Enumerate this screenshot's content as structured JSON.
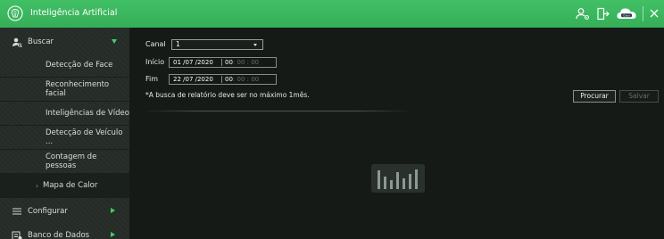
{
  "app": {
    "title": "Inteligência Artificial",
    "accent": "#3fb862"
  },
  "header_icons": [
    "user-settings-icon",
    "logout-icon",
    "cloud-icon",
    "close-icon"
  ],
  "cloud_badge": "Intelbras\nCloud",
  "sidebar": {
    "buscar": {
      "label": "Buscar",
      "icon": "search-person-icon"
    },
    "sub_items": [
      {
        "label": "Detecção de Face"
      },
      {
        "label": "Reconhecimento facial"
      },
      {
        "label": "Inteligências de Vídeo"
      },
      {
        "label": "Detecção de Veículo ..."
      },
      {
        "label": "Contagem de pessoas"
      },
      {
        "label": "Mapa de Calor",
        "active": true,
        "bullet": "›"
      }
    ],
    "configurar": {
      "label": "Configurar",
      "icon": "list-icon"
    },
    "banco": {
      "label": "Banco de Dados",
      "icon": "database-icon"
    }
  },
  "form": {
    "canal_label": "Canal",
    "canal_value": "1",
    "inicio_label": "Início",
    "inicio_date": "01 /07 /2020",
    "inicio_time_hh": "00",
    "inicio_time_rest": ": 00 : 00",
    "fim_label": "Fim",
    "fim_date": "22 /07 /2020",
    "fim_time_hh": "00",
    "fim_time_rest": ": 00 : 00",
    "note": "*A busca de relatório deve ser no máximo 1mês."
  },
  "buttons": {
    "search": "Procurar",
    "save": "Salvar"
  }
}
